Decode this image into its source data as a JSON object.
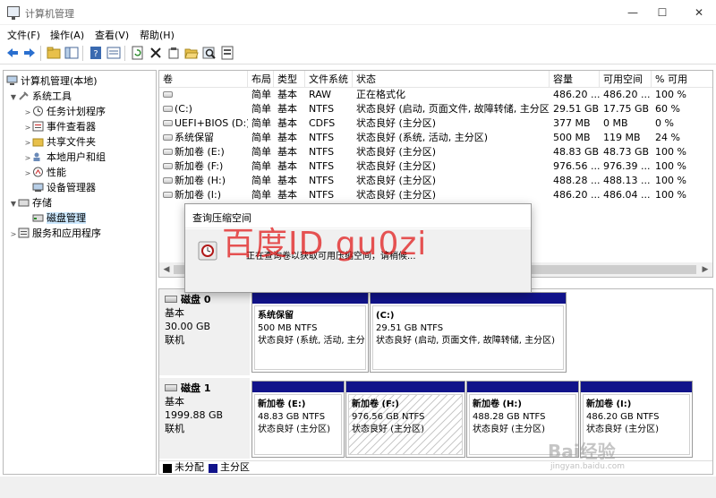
{
  "window": {
    "title": "计算机管理"
  },
  "window_controls": {
    "minimize": "—",
    "maximize": "☐",
    "close": "✕"
  },
  "menu": [
    "文件(F)",
    "操作(A)",
    "查看(V)",
    "帮助(H)"
  ],
  "tree": {
    "root": "计算机管理(本地)",
    "system_tools": "系统工具",
    "task_scheduler": "任务计划程序",
    "event_viewer": "事件查看器",
    "shared_folders": "共享文件夹",
    "local_users": "本地用户和组",
    "performance": "性能",
    "device_manager": "设备管理器",
    "storage": "存储",
    "disk_management": "磁盘管理",
    "services_apps": "服务和应用程序"
  },
  "volume_table": {
    "headers": [
      "卷",
      "布局",
      "类型",
      "文件系统",
      "状态",
      "容量",
      "可用空间",
      "% 可用"
    ],
    "rows": [
      {
        "name": "",
        "layout": "简单",
        "type": "基本",
        "fs": "RAW",
        "status": "正在格式化",
        "capacity": "486.20 ...",
        "free": "486.20 ...",
        "pct": "100 %"
      },
      {
        "name": "(C:)",
        "layout": "简单",
        "type": "基本",
        "fs": "NTFS",
        "status": "状态良好 (启动, 页面文件, 故障转储, 主分区)",
        "capacity": "29.51 GB",
        "free": "17.75 GB",
        "pct": "60 %"
      },
      {
        "name": "UEFI+BIOS (D:)",
        "layout": "简单",
        "type": "基本",
        "fs": "CDFS",
        "status": "状态良好 (主分区)",
        "capacity": "377 MB",
        "free": "0 MB",
        "pct": "0 %"
      },
      {
        "name": "系统保留",
        "layout": "简单",
        "type": "基本",
        "fs": "NTFS",
        "status": "状态良好 (系统, 活动, 主分区)",
        "capacity": "500 MB",
        "free": "119 MB",
        "pct": "24 %"
      },
      {
        "name": "新加卷 (E:)",
        "layout": "简单",
        "type": "基本",
        "fs": "NTFS",
        "status": "状态良好 (主分区)",
        "capacity": "48.83 GB",
        "free": "48.73 GB",
        "pct": "100 %"
      },
      {
        "name": "新加卷 (F:)",
        "layout": "简单",
        "type": "基本",
        "fs": "NTFS",
        "status": "状态良好 (主分区)",
        "capacity": "976.56 ...",
        "free": "976.39 ...",
        "pct": "100 %"
      },
      {
        "name": "新加卷 (H:)",
        "layout": "简单",
        "type": "基本",
        "fs": "NTFS",
        "status": "状态良好 (主分区)",
        "capacity": "488.28 ...",
        "free": "488.13 ...",
        "pct": "100 %"
      },
      {
        "name": "新加卷 (I:)",
        "layout": "简单",
        "type": "基本",
        "fs": "NTFS",
        "status": "状态良好 (主分区)",
        "capacity": "486.20 ...",
        "free": "486.04 ...",
        "pct": "100 %"
      }
    ]
  },
  "disk0": {
    "title": "磁盘 0",
    "type": "基本",
    "size": "30.00 GB",
    "state": "联机",
    "partitions": [
      {
        "name": "系统保留",
        "size": "500 MB NTFS",
        "status": "状态良好 (系统, 活动, 主分区)"
      },
      {
        "name": "(C:)",
        "size": "29.51 GB NTFS",
        "status": "状态良好 (启动, 页面文件, 故障转储, 主分区)"
      }
    ]
  },
  "disk1": {
    "title": "磁盘 1",
    "type": "基本",
    "size": "1999.88 GB",
    "state": "联机",
    "partitions": [
      {
        "name": "新加卷 (E:)",
        "size": "48.83 GB NTFS",
        "status": "状态良好 (主分区)"
      },
      {
        "name": "新加卷 (F:)",
        "size": "976.56 GB NTFS",
        "status": "状态良好 (主分区)"
      },
      {
        "name": "新加卷 (H:)",
        "size": "488.28 GB NTFS",
        "status": "状态良好 (主分区)"
      },
      {
        "name": "新加卷 (I:)",
        "size": "486.20 GB NTFS",
        "status": "状态良好 (主分区)"
      }
    ]
  },
  "legend": {
    "unallocated": "未分配",
    "primary": "主分区",
    "unallocated_color": "#000000",
    "primary_color": "#11138a"
  },
  "dialog": {
    "title": "查询压缩空间",
    "message": "正在查询卷以获取可用压缩空间，请稍候..."
  },
  "watermark": {
    "text": "百度ID gu0zi",
    "brand": "Bai经验",
    "url": "jingyan.baidu.com"
  },
  "colors": {
    "accent": "#11138a",
    "selection": "#cce8ff",
    "watermark_red": "#e11414"
  }
}
